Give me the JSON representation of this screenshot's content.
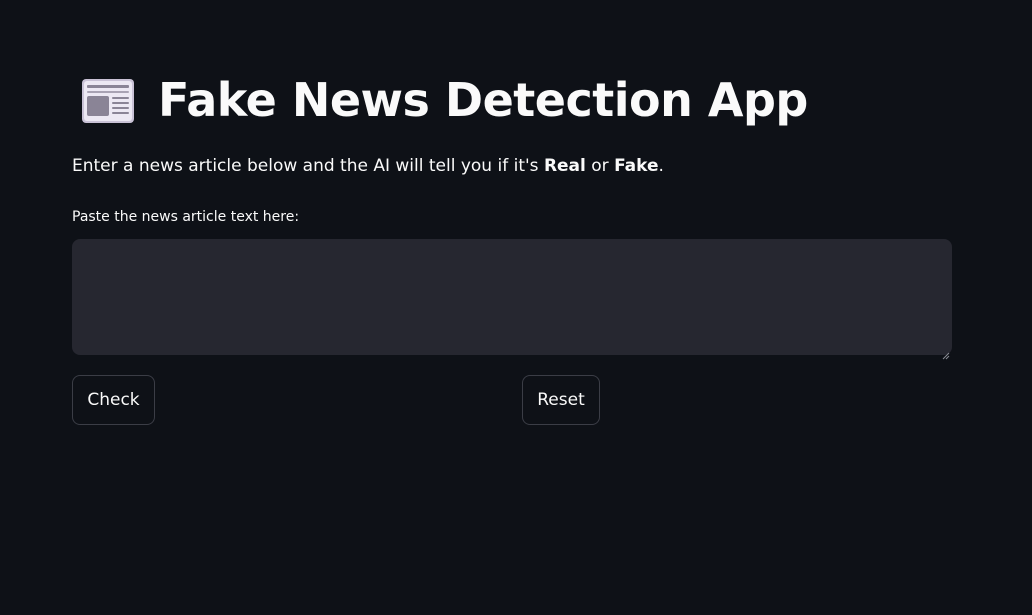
{
  "header": {
    "icon": "newspaper-icon",
    "title": "Fake News Detection App"
  },
  "intro": {
    "prefix": "Enter a news article below and the AI will tell you if it's ",
    "real": "Real",
    "middle": " or ",
    "fake": "Fake",
    "suffix": "."
  },
  "article_input": {
    "label": "Paste the news article text here:",
    "value": "",
    "placeholder": ""
  },
  "buttons": {
    "check_label": "Check",
    "reset_label": "Reset"
  },
  "colors": {
    "background": "#0e1117",
    "input_background": "#262730",
    "text": "#fafafa",
    "button_border": "#3b3d46"
  }
}
